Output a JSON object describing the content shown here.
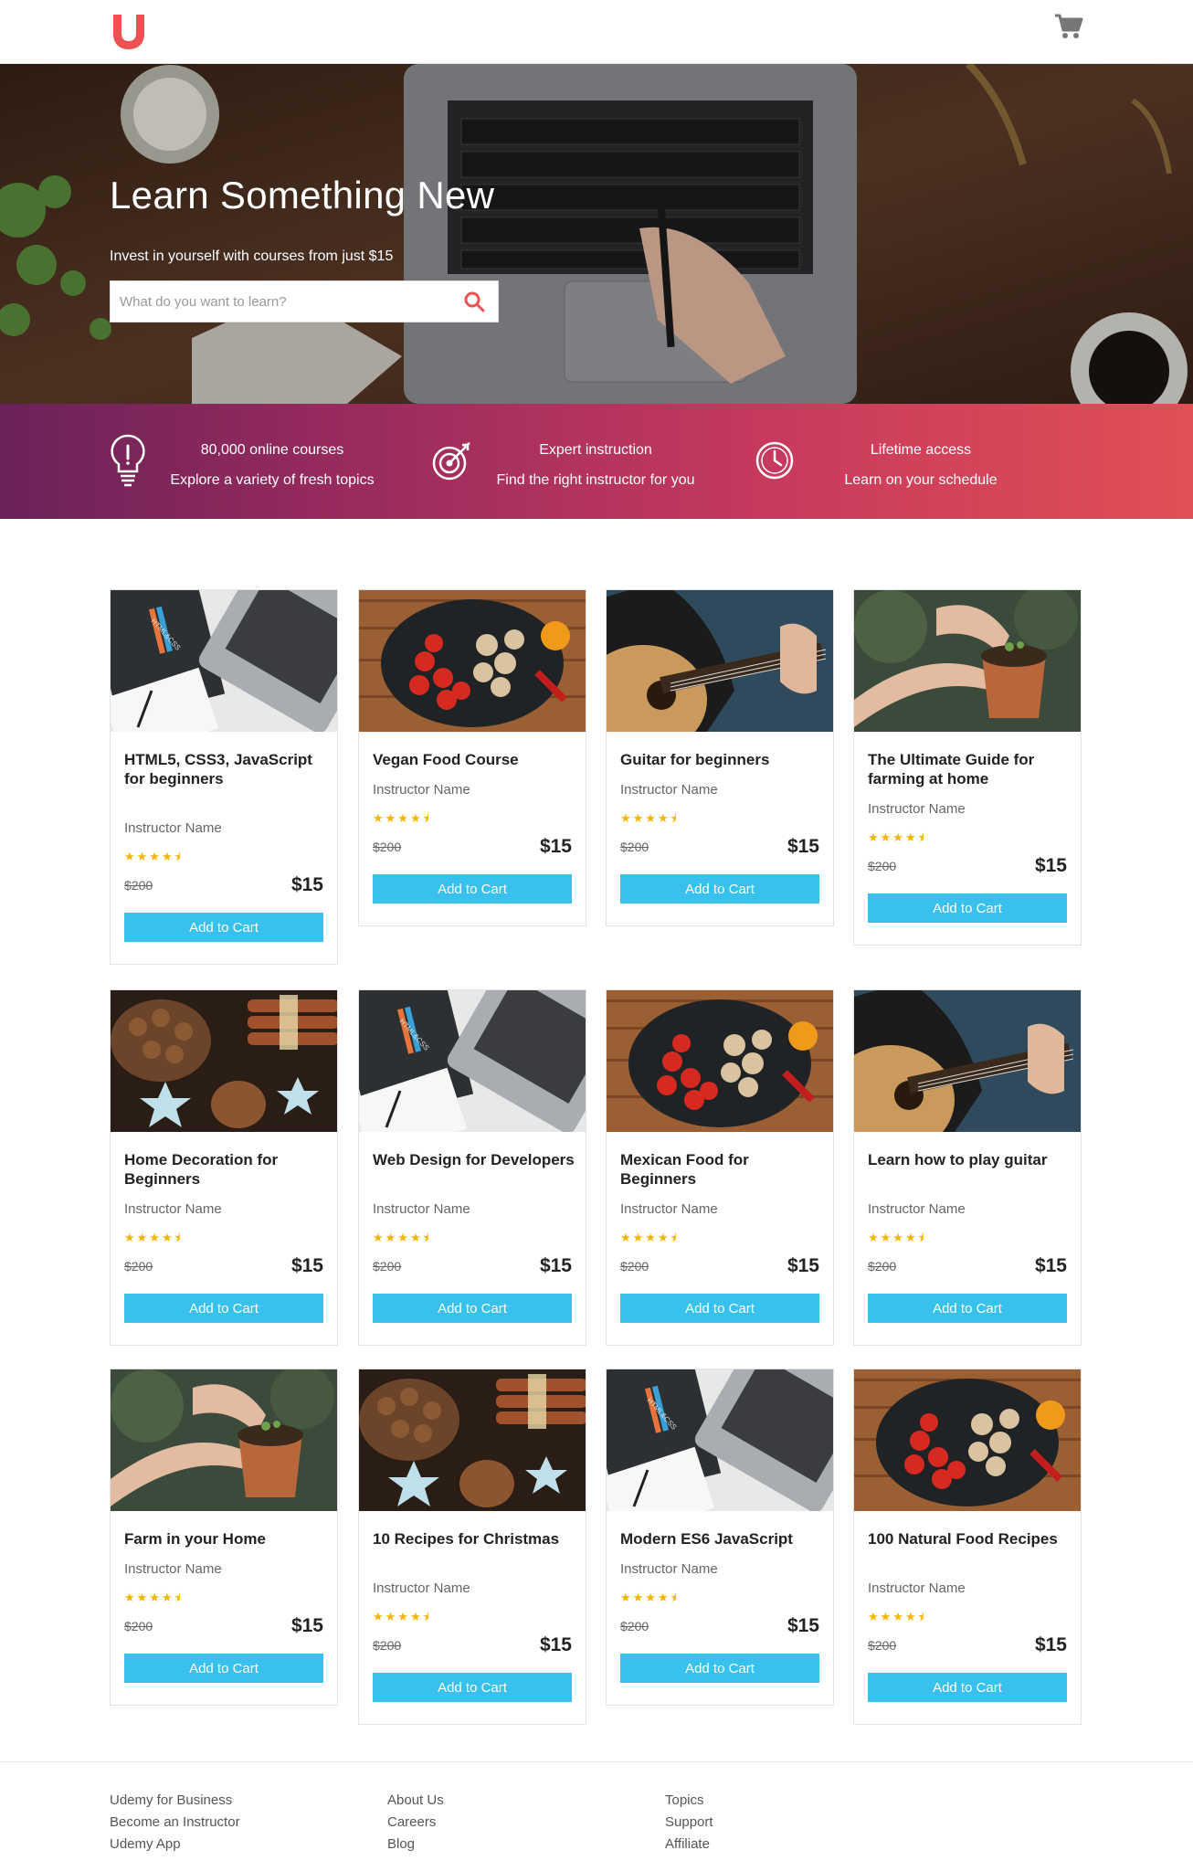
{
  "header": {
    "logo": "udemy-logo",
    "cart_icon": "cart-icon"
  },
  "hero": {
    "title": "Learn Something New",
    "subtitle": "Invest in yourself with courses from just $15",
    "search_placeholder": "What do you want to learn?",
    "search_icon": "search-icon"
  },
  "features": [
    {
      "icon": "lightbulb-icon",
      "line1": "80,000 online courses",
      "line2": "Explore a variety of fresh topics"
    },
    {
      "icon": "target-icon",
      "line1": "Expert instruction",
      "line2": "Find the right instructor for you"
    },
    {
      "icon": "clock-icon",
      "line1": "Lifetime access",
      "line2": "Learn on your schedule"
    }
  ],
  "courses": [
    {
      "title": "HTML5, CSS3, JavaScript for beginners",
      "instructor": "Instructor Name",
      "rating": 4.5,
      "old_price": "$200",
      "price": "$15",
      "button": "Add to Cart",
      "image": "laptop-notebook"
    },
    {
      "title": "Vegan Food Course",
      "instructor": "Instructor Name",
      "rating": 4.5,
      "old_price": "$200",
      "price": "$15",
      "button": "Add to Cart",
      "image": "food-pan"
    },
    {
      "title": "Guitar for beginners",
      "instructor": "Instructor Name",
      "rating": 4.5,
      "old_price": "$200",
      "price": "$15",
      "button": "Add to Cart",
      "image": "guitar"
    },
    {
      "title": "The Ultimate Guide for farming at home",
      "instructor": "Instructor Name",
      "rating": 4.5,
      "old_price": "$200",
      "price": "$15",
      "button": "Add to Cart",
      "image": "plant-pot"
    },
    {
      "title": "Home Decoration for Beginners",
      "instructor": "Instructor Name",
      "rating": 4.5,
      "old_price": "$200",
      "price": "$15",
      "button": "Add to Cart",
      "image": "christmas-decor"
    },
    {
      "title": "Web Design for Developers",
      "instructor": "Instructor Name",
      "rating": 4.5,
      "old_price": "$200",
      "price": "$15",
      "button": "Add to Cart",
      "image": "laptop-notebook"
    },
    {
      "title": "Mexican Food for Beginners",
      "instructor": "Instructor Name",
      "rating": 4.5,
      "old_price": "$200",
      "price": "$15",
      "button": "Add to Cart",
      "image": "food-pan"
    },
    {
      "title": "Learn how to play guitar",
      "instructor": "Instructor Name",
      "rating": 4.5,
      "old_price": "$200",
      "price": "$15",
      "button": "Add to Cart",
      "image": "guitar"
    },
    {
      "title": "Farm in your Home",
      "instructor": "Instructor Name",
      "rating": 4.5,
      "old_price": "$200",
      "price": "$15",
      "button": "Add to Cart",
      "image": "plant-pot"
    },
    {
      "title": "10 Recipes for Christmas",
      "instructor": "Instructor Name",
      "rating": 4.5,
      "old_price": "$200",
      "price": "$15",
      "button": "Add to Cart",
      "image": "christmas-decor"
    },
    {
      "title": "Modern ES6 JavaScript",
      "instructor": "Instructor Name",
      "rating": 4.5,
      "old_price": "$200",
      "price": "$15",
      "button": "Add to Cart",
      "image": "laptop-notebook"
    },
    {
      "title": "100 Natural Food Recipes",
      "instructor": "Instructor Name",
      "rating": 4.5,
      "old_price": "$200",
      "price": "$15",
      "button": "Add to Cart",
      "image": "food-pan"
    }
  ],
  "footer": {
    "columns": [
      [
        "Udemy for Business",
        "Become an Instructor",
        "Udemy App"
      ],
      [
        "About Us",
        "Careers",
        "Blog"
      ],
      [
        "Topics",
        "Support",
        "Affiliate"
      ]
    ]
  },
  "colors": {
    "accent": "#37c1ec",
    "brand": "#ec5252",
    "star": "#f4b400"
  }
}
